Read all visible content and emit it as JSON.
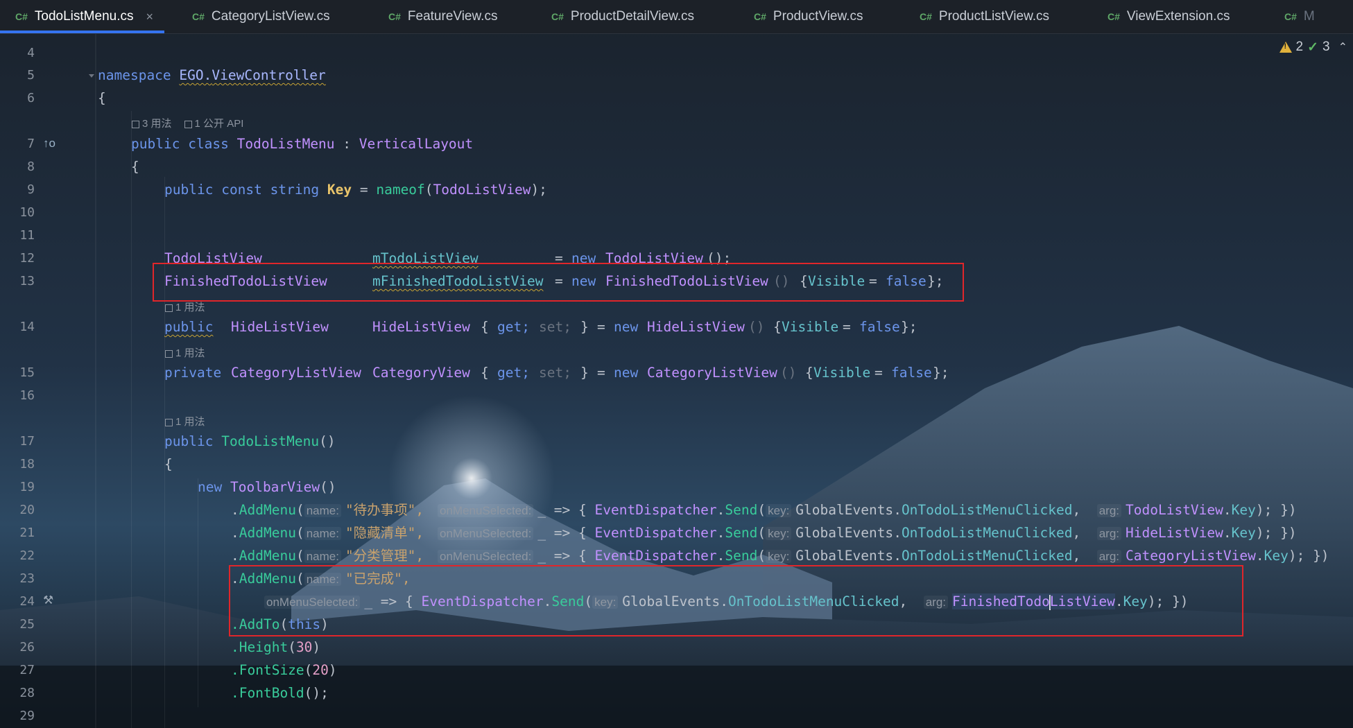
{
  "tabs": [
    {
      "lang": "C#",
      "label": "TodoListMenu.cs",
      "active": true,
      "close": "×"
    },
    {
      "lang": "C#",
      "label": "CategoryListView.cs"
    },
    {
      "lang": "C#",
      "label": "FeatureView.cs"
    },
    {
      "lang": "C#",
      "label": "ProductDetailView.cs"
    },
    {
      "lang": "C#",
      "label": "ProductView.cs"
    },
    {
      "lang": "C#",
      "label": "ProductListView.cs"
    },
    {
      "lang": "C#",
      "label": "ViewExtension.cs"
    },
    {
      "lang": "C#",
      "label": "M"
    }
  ],
  "inspections": {
    "warnings": "2",
    "ok": "3"
  },
  "hints": {
    "class": {
      "usages": "3 用法",
      "api": "1 公开 API"
    },
    "one_usage": "1 用法"
  },
  "line_numbers": [
    "4",
    "5",
    "6",
    "7",
    "8",
    "9",
    "10",
    "11",
    "12",
    "13",
    "14",
    "15",
    "16",
    "17",
    "18",
    "19",
    "20",
    "21",
    "22",
    "23",
    "24",
    "25",
    "26",
    "27",
    "28",
    "29"
  ],
  "code": {
    "l5": {
      "kw": "namespace",
      "ns1": "EGO",
      "dot": ".",
      "ns2": "ViewController"
    },
    "l6": "{",
    "l7": {
      "kw1": "public",
      "kw2": "class",
      "name": "TodoListMenu",
      "colon": ":",
      "base": "VerticalLayout"
    },
    "l8": "{",
    "l9": {
      "kw1": "public",
      "kw2": "const",
      "kw3": "string",
      "name": "Key",
      "eq": "=",
      "fn": "nameof",
      "open": "(",
      "arg": "TodoListView",
      "close": ");"
    },
    "l12": {
      "type": "TodoListView",
      "field": "mTodoListView",
      "eq": "=",
      "kw": "new",
      "ctor": "TodoListView",
      "tail": "();"
    },
    "l13": {
      "type": "FinishedTodoListView",
      "field": "mFinishedTodoListView",
      "eq": "=",
      "kw": "new",
      "ctor": "FinishedTodoListView",
      "paren": "()",
      "open": "{",
      "prop": "Visible",
      "eq2": "=",
      "val": "false",
      "close": "};"
    },
    "l14": {
      "kw": "public",
      "type": "HideListView",
      "name": "HideListView",
      "ob": "{",
      "get": "get;",
      "set": "set;",
      "cb": "}",
      "eq": "=",
      "kw2": "new",
      "ctor": "HideListView",
      "paren": "()",
      "open": "{",
      "prop": "Visible",
      "eq2": "=",
      "val": "false",
      "close": "};"
    },
    "l15": {
      "kw": "private",
      "type": "CategoryListView",
      "name": "CategoryView",
      "ob": "{",
      "get": "get;",
      "set": "set;",
      "cb": "}",
      "eq": "=",
      "kw2": "new",
      "ctor": "CategoryListView",
      "paren": "()",
      "open": "{",
      "prop": "Visible",
      "eq2": "=",
      "val": "false",
      "close": "};"
    },
    "l17": {
      "kw": "public",
      "name": "TodoListMenu",
      "paren": "()"
    },
    "l18": "{",
    "l19": {
      "kw": "new",
      "ctor": "ToolbarView",
      "paren": "()"
    },
    "menu_common": {
      "dot": ".",
      "method": "AddMenu",
      "open": "(",
      "p_name": "name:",
      "p_sel": "onMenuSelected:",
      "lambda": "_ => {",
      "cls": "EventDispatcher",
      "send": "Send",
      "sopen": "(",
      "p_key": "key:",
      "ge": "GlobalEvents",
      "evt": "OnTodoListMenuClicked",
      "comma": ",",
      "p_arg": "arg:",
      "key": "Key",
      "end": "); })"
    },
    "l20": {
      "label": "\"待办事项\",",
      "view": "TodoListView"
    },
    "l21": {
      "label": "\"隐藏清单\",",
      "view": "HideListView"
    },
    "l22": {
      "label": "\"分类管理\",",
      "view": "CategoryListView"
    },
    "l23": {
      "label": "\"已完成\","
    },
    "l24": {
      "view1": "FinishedTodo",
      "view2": "ListView"
    },
    "l25": {
      "method": ".AddTo",
      "open": "(",
      "kw": "this",
      "close": ")"
    },
    "l26": {
      "method": ".Height",
      "open": "(",
      "num": "30",
      "close": ")"
    },
    "l27": {
      "method": ".FontSize",
      "open": "(",
      "num": "20",
      "close": ")"
    },
    "l28": {
      "method": ".FontBold",
      "close": "();"
    }
  }
}
